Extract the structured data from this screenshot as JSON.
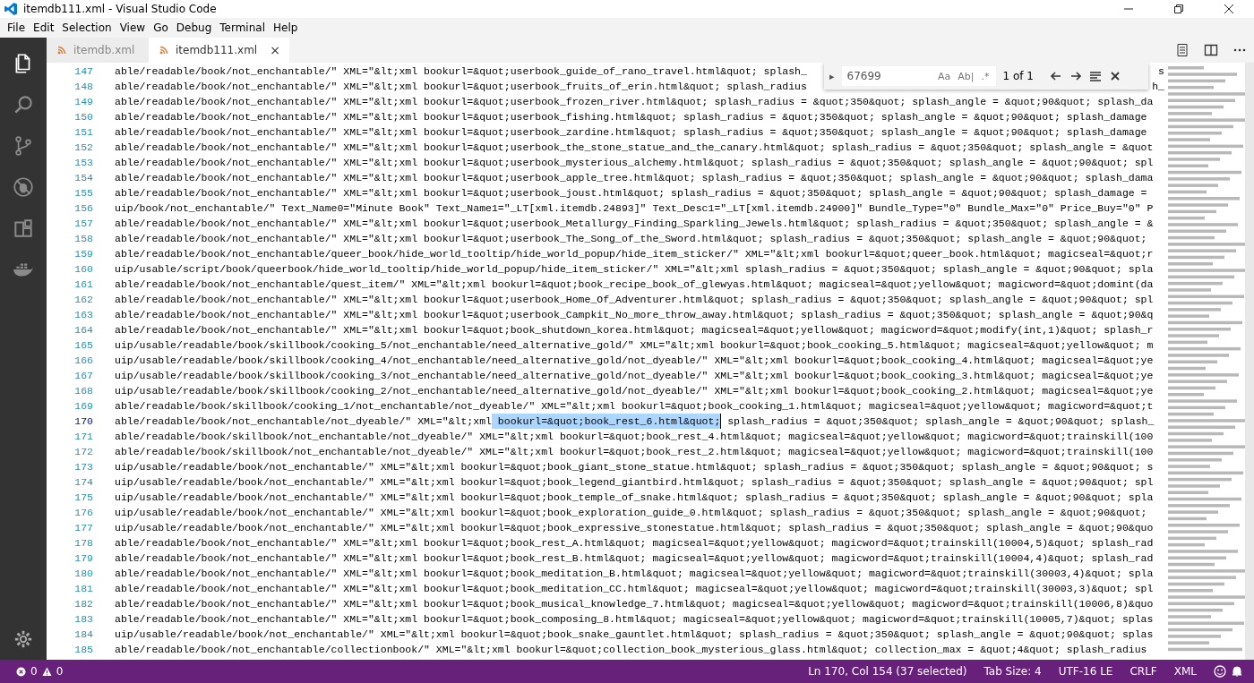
{
  "window": {
    "title": "itemdb111.xml - Visual Studio Code"
  },
  "menu": [
    "File",
    "Edit",
    "Selection",
    "View",
    "Go",
    "Debug",
    "Terminal",
    "Help"
  ],
  "activity_bar": [
    {
      "kind": "files",
      "selected": true
    },
    {
      "kind": "search",
      "selected": false
    },
    {
      "kind": "scm",
      "selected": false
    },
    {
      "kind": "debug",
      "selected": false
    },
    {
      "kind": "extensions",
      "selected": false
    },
    {
      "kind": "docker",
      "selected": false
    }
  ],
  "tabs": [
    {
      "label": "itemdb.xml",
      "selected": false
    },
    {
      "label": "itemdb111.xml",
      "selected": true,
      "close": "×"
    }
  ],
  "find_widget": {
    "expand": "▸",
    "match_case_label": "Aa",
    "whole_word_label": "Ab|",
    "regex_label": ".*",
    "value": "67699",
    "match_case": false,
    "whole_word": false,
    "regex": false,
    "result": "1 of 1"
  },
  "lines": [
    {
      "number": "147",
      "current": false,
      "text": "able/readable/book/not_enchantable/\" XML=\"&lt;xml bookurl=&quot;userbook_guide_of_rano_travel.html&quot; splash_",
      "tail": "s"
    },
    {
      "number": "148",
      "current": false,
      "text": "able/readable/book/not_enchantable/\" XML=\"&lt;xml bookurl=&quot;userbook_fruits_of_erin.html&quot; splash_radius",
      "tail": "h_"
    },
    {
      "number": "149",
      "current": false,
      "text": "able/readable/book/not_enchantable/\" XML=\"&lt;xml bookurl=&quot;userbook_frozen_river.html&quot; splash_radius = &quot;350&quot; splash_angle = &quot;90&quot; splash_da"
    },
    {
      "number": "150",
      "current": false,
      "text": "able/readable/book/not_enchantable/\" XML=\"&lt;xml bookurl=&quot;userbook_fishing.html&quot; splash_radius = &quot;350&quot; splash_angle = &quot;90&quot; splash_damage"
    },
    {
      "number": "151",
      "current": false,
      "text": "able/readable/book/not_enchantable/\" XML=\"&lt;xml bookurl=&quot;userbook_zardine.html&quot; splash_radius = &quot;350&quot; splash_angle = &quot;90&quot; splash_damage"
    },
    {
      "number": "152",
      "current": false,
      "text": "able/readable/book/not_enchantable/\" XML=\"&lt;xml bookurl=&quot;userbook_the_stone_statue_and_the_canary.html&quot; splash_radius = &quot;350&quot; splash_angle = &quot"
    },
    {
      "number": "153",
      "current": false,
      "text": "able/readable/book/not_enchantable/\" XML=\"&lt;xml bookurl=&quot;userbook_mysterious_alchemy.html&quot; splash_radius = &quot;350&quot; splash_angle = &quot;90&quot; spl"
    },
    {
      "number": "154",
      "current": false,
      "text": "able/readable/book/not_enchantable/\" XML=\"&lt;xml bookurl=&quot;userbook_apple_tree.html&quot; splash_radius = &quot;350&quot; splash_angle = &quot;90&quot; splash_dama"
    },
    {
      "number": "155",
      "current": false,
      "text": "able/readable/book/not_enchantable/\" XML=\"&lt;xml bookurl=&quot;userbook_joust.html&quot; splash_radius = &quot;350&quot; splash_angle = &quot;90&quot; splash_damage ="
    },
    {
      "number": "156",
      "current": false,
      "text": "uip/book/not_enchantable/\" Text_Name0=\"Minute Book\" Text_Name1=\"_LT[xml.itemdb.24893]\" Text_Desc1=\"_LT[xml.itemdb.24900]\" Bundle_Type=\"0\" Bundle_Max=\"0\" Price_Buy=\"0\" P"
    },
    {
      "number": "157",
      "current": false,
      "text": "able/readable/book/not_enchantable/\" XML=\"&lt;xml bookurl=&quot;userbook_Metallurgy_Finding_Sparkling_Jewels.html&quot; splash_radius = &quot;350&quot; splash_angle = &"
    },
    {
      "number": "158",
      "current": false,
      "text": "able/readable/book/not_enchantable/\" XML=\"&lt;xml bookurl=&quot;userbook_The_Song_of_the_Sword.html&quot; splash_radius = &quot;350&quot; splash_angle = &quot;90&quot;"
    },
    {
      "number": "159",
      "current": false,
      "text": "able/readable/book/not_enchantable/queer_book/hide_world_tooltip/hide_world_popup/hide_item_sticker/\" XML=\"&lt;xml bookurl=&quot;queer_book.html&quot; magicseal=&quot;r"
    },
    {
      "number": "160",
      "current": false,
      "text": "uip/usable/script/book/queerbook/hide_world_tooltip/hide_world_popup/hide_item_sticker/\" XML=\"&lt;xml splash_radius = &quot;350&quot; splash_angle = &quot;90&quot; spla"
    },
    {
      "number": "161",
      "current": false,
      "text": "able/readable/book/not_enchantable/quest_item/\" XML=\"&lt;xml bookurl=&quot;book_recipe_book_of_glewyas.html&quot; magicseal=&quot;yellow&quot; magicword=&quot;domint(da"
    },
    {
      "number": "162",
      "current": false,
      "text": "able/readable/book/not_enchantable/\" XML=\"&lt;xml bookurl=&quot;userbook_Home_Of_Adventurer.html&quot; splash_radius = &quot;350&quot; splash_angle = &quot;90&quot; spl"
    },
    {
      "number": "163",
      "current": false,
      "text": "able/readable/book/not_enchantable/\" XML=\"&lt;xml bookurl=&quot;userbook_Campkit_No_more_throw_away.html&quot; splash_radius = &quot;350&quot; splash_angle = &quot;90&q"
    },
    {
      "number": "164",
      "current": false,
      "text": "able/readable/book/not_enchantable/\" XML=\"&lt;xml bookurl=&quot;book_shutdown_korea.html&quot; magicseal=&quot;yellow&quot; magicword=&quot;modify(int,1)&quot; splash_r"
    },
    {
      "number": "165",
      "current": false,
      "text": "uip/usable/readable/book/skillbook/cooking_5/not_enchantable/need_alternative_gold/\" XML=\"&lt;xml bookurl=&quot;book_cooking_5.html&quot; magicseal=&quot;yellow&quot; m"
    },
    {
      "number": "166",
      "current": false,
      "text": "uip/usable/readable/book/skillbook/cooking_4/not_enchantable/need_alternative_gold/not_dyeable/\" XML=\"&lt;xml bookurl=&quot;book_cooking_4.html&quot; magicseal=&quot;ye"
    },
    {
      "number": "167",
      "current": false,
      "text": "uip/usable/readable/book/skillbook/cooking_3/not_enchantable/need_alternative_gold/not_dyeable/\" XML=\"&lt;xml bookurl=&quot;book_cooking_3.html&quot; magicseal=&quot;ye"
    },
    {
      "number": "168",
      "current": false,
      "text": "uip/usable/readable/book/skillbook/cooking_2/not_enchantable/need_alternative_gold/not_dyeable/\" XML=\"&lt;xml bookurl=&quot;book_cooking_2.html&quot; magicseal=&quot;ye"
    },
    {
      "number": "169",
      "current": false,
      "text": "able/readable/book/skillbook/cooking_1/not_enchantable/not_dyeable/\" XML=\"&lt;xml bookurl=&quot;book_cooking_1.html&quot; magicseal=&quot;yellow&quot; magicword=&quot;t"
    },
    {
      "number": "170",
      "current": true,
      "text": "able/readable/book/not_enchantable/not_dyeable/\" XML=\"&lt;xml",
      "selection": " bookurl=&quot;book_rest_6.html&quot;",
      "after": " splash_radius = &quot;350&quot; splash_angle = &quot;90&quot; splash_"
    },
    {
      "number": "171",
      "current": false,
      "text": "able/readable/book/skillbook/not_enchantable/not_dyeable/\" XML=\"&lt;xml bookurl=&quot;book_rest_4.html&quot; magicseal=&quot;yellow&quot; magicword=&quot;trainskill(100"
    },
    {
      "number": "172",
      "current": false,
      "text": "able/readable/book/skillbook/not_enchantable/not_dyeable/\" XML=\"&lt;xml bookurl=&quot;book_rest_2.html&quot; magicseal=&quot;yellow&quot; magicword=&quot;trainskill(100"
    },
    {
      "number": "173",
      "current": false,
      "text": "uip/usable/readable/book/not_enchantable/\" XML=\"&lt;xml bookurl=&quot;book_giant_stone_statue.html&quot; splash_radius = &quot;350&quot; splash_angle = &quot;90&quot; s"
    },
    {
      "number": "174",
      "current": false,
      "text": "uip/usable/readable/book/not_enchantable/\" XML=\"&lt;xml bookurl=&quot;book_legend_giantbird.html&quot; splash_radius = &quot;350&quot; splash_angle = &quot;90&quot; spl"
    },
    {
      "number": "175",
      "current": false,
      "text": "uip/usable/readable/book/not_enchantable/\" XML=\"&lt;xml bookurl=&quot;book_temple_of_snake.html&quot; splash_radius = &quot;350&quot; splash_angle = &quot;90&quot; spla"
    },
    {
      "number": "176",
      "current": false,
      "text": "uip/usable/readable/book/not_enchantable/\" XML=\"&lt;xml bookurl=&quot;book_exploration_guide_0.html&quot; splash_radius = &quot;350&quot; splash_angle = &quot;90&quot;"
    },
    {
      "number": "177",
      "current": false,
      "text": "uip/usable/readable/book/not_enchantable/\" XML=\"&lt;xml bookurl=&quot;book_expressive_stonestatue.html&quot; splash_radius = &quot;350&quot; splash_angle = &quot;90&quo"
    },
    {
      "number": "178",
      "current": false,
      "text": "able/readable/book/not_enchantable/\" XML=\"&lt;xml bookurl=&quot;book_rest_A.html&quot; magicseal=&quot;yellow&quot; magicword=&quot;trainskill(10004,5)&quot; splash_rad"
    },
    {
      "number": "179",
      "current": false,
      "text": "able/readable/book/not_enchantable/\" XML=\"&lt;xml bookurl=&quot;book_rest_B.html&quot; magicseal=&quot;yellow&quot; magicword=&quot;trainskill(10004,4)&quot; splash_rad"
    },
    {
      "number": "180",
      "current": false,
      "text": "able/readable/book/not_enchantable/\" XML=\"&lt;xml bookurl=&quot;book_meditation_B.html&quot; magicseal=&quot;yellow&quot; magicword=&quot;trainskill(30003,4)&quot; spla"
    },
    {
      "number": "181",
      "current": false,
      "text": "able/readable/book/not_enchantable/\" XML=\"&lt;xml bookurl=&quot;book_meditation_CC.html&quot; magicseal=&quot;yellow&quot; magicword=&quot;trainskill(30003,3)&quot; spl"
    },
    {
      "number": "182",
      "current": false,
      "text": "able/readable/book/not_enchantable/\" XML=\"&lt;xml bookurl=&quot;book_musical_knowledge_7.html&quot; magicseal=&quot;yellow&quot; magicword=&quot;trainskill(10006,8)&quo"
    },
    {
      "number": "183",
      "current": false,
      "text": "able/readable/book/not_enchantable/\" XML=\"&lt;xml bookurl=&quot;book_composing_8.html&quot; magicseal=&quot;yellow&quot; magicword=&quot;trainskill(10005,7)&quot; splas"
    },
    {
      "number": "184",
      "current": false,
      "text": "uip/usable/readable/book/not_enchantable/\" XML=\"&lt;xml bookurl=&quot;book_snake_gauntlet.html&quot; splash_radius = &quot;350&quot; splash_angle = &quot;90&quot; splas"
    },
    {
      "number": "185",
      "current": false,
      "text": "able/readable/book/not_enchantable/collectionbook/\" XML=\"&lt;xml bookurl=&quot;collection_book_mysterious_glass.html&quot; collection_max = &quot;4&quot; splash_radius"
    }
  ],
  "status_bar": {
    "errors": "0",
    "warnings": "0",
    "position": "Ln 170, Col 154 (37 selected)",
    "tab_size": "Tab Size: 4",
    "encoding": "UTF-16 LE",
    "eol": "CRLF",
    "language": "XML"
  }
}
